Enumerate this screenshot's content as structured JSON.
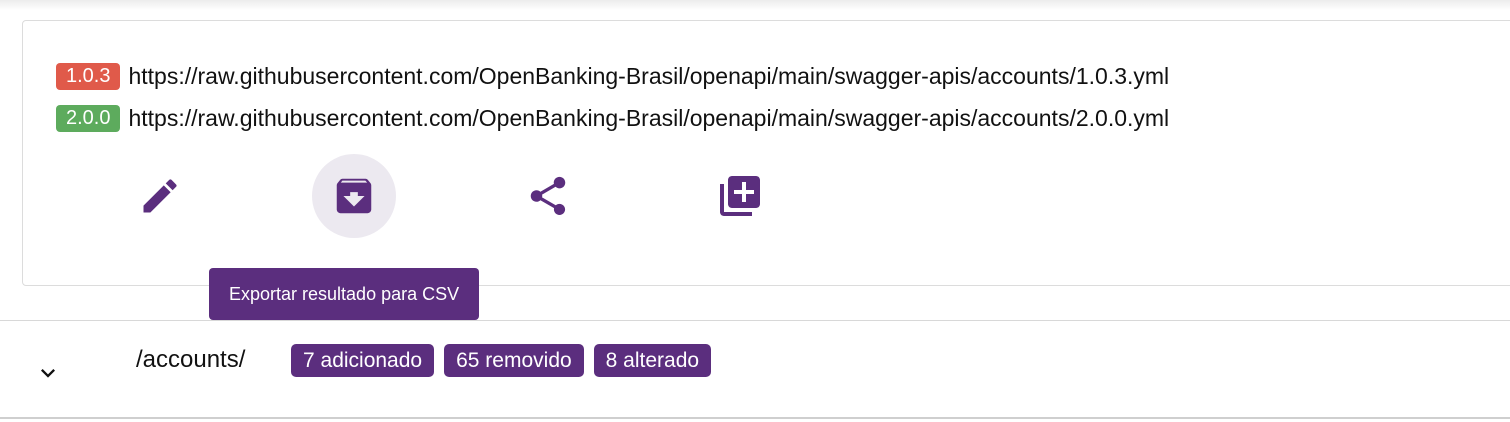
{
  "colors": {
    "accent": "#5b2e7e",
    "version_old": "#e05a4a",
    "version_new": "#5dab5d"
  },
  "specs": [
    {
      "version": "1.0.3",
      "url": "https://raw.githubusercontent.com/OpenBanking-Brasil/openapi/main/swagger-apis/accounts/1.0.3.yml"
    },
    {
      "version": "2.0.0",
      "url": "https://raw.githubusercontent.com/OpenBanking-Brasil/openapi/main/swagger-apis/accounts/2.0.0.yml"
    }
  ],
  "actions": {
    "icons": [
      "pencil-icon",
      "archive-download-icon",
      "share-icon",
      "library-add-icon"
    ],
    "tooltip": "Exportar resultado para CSV"
  },
  "path_section": {
    "expand_icon": "chevron-down-icon",
    "path": "/accounts/",
    "chips": [
      "7 adicionado",
      "65 removido",
      "8 alterado"
    ]
  }
}
